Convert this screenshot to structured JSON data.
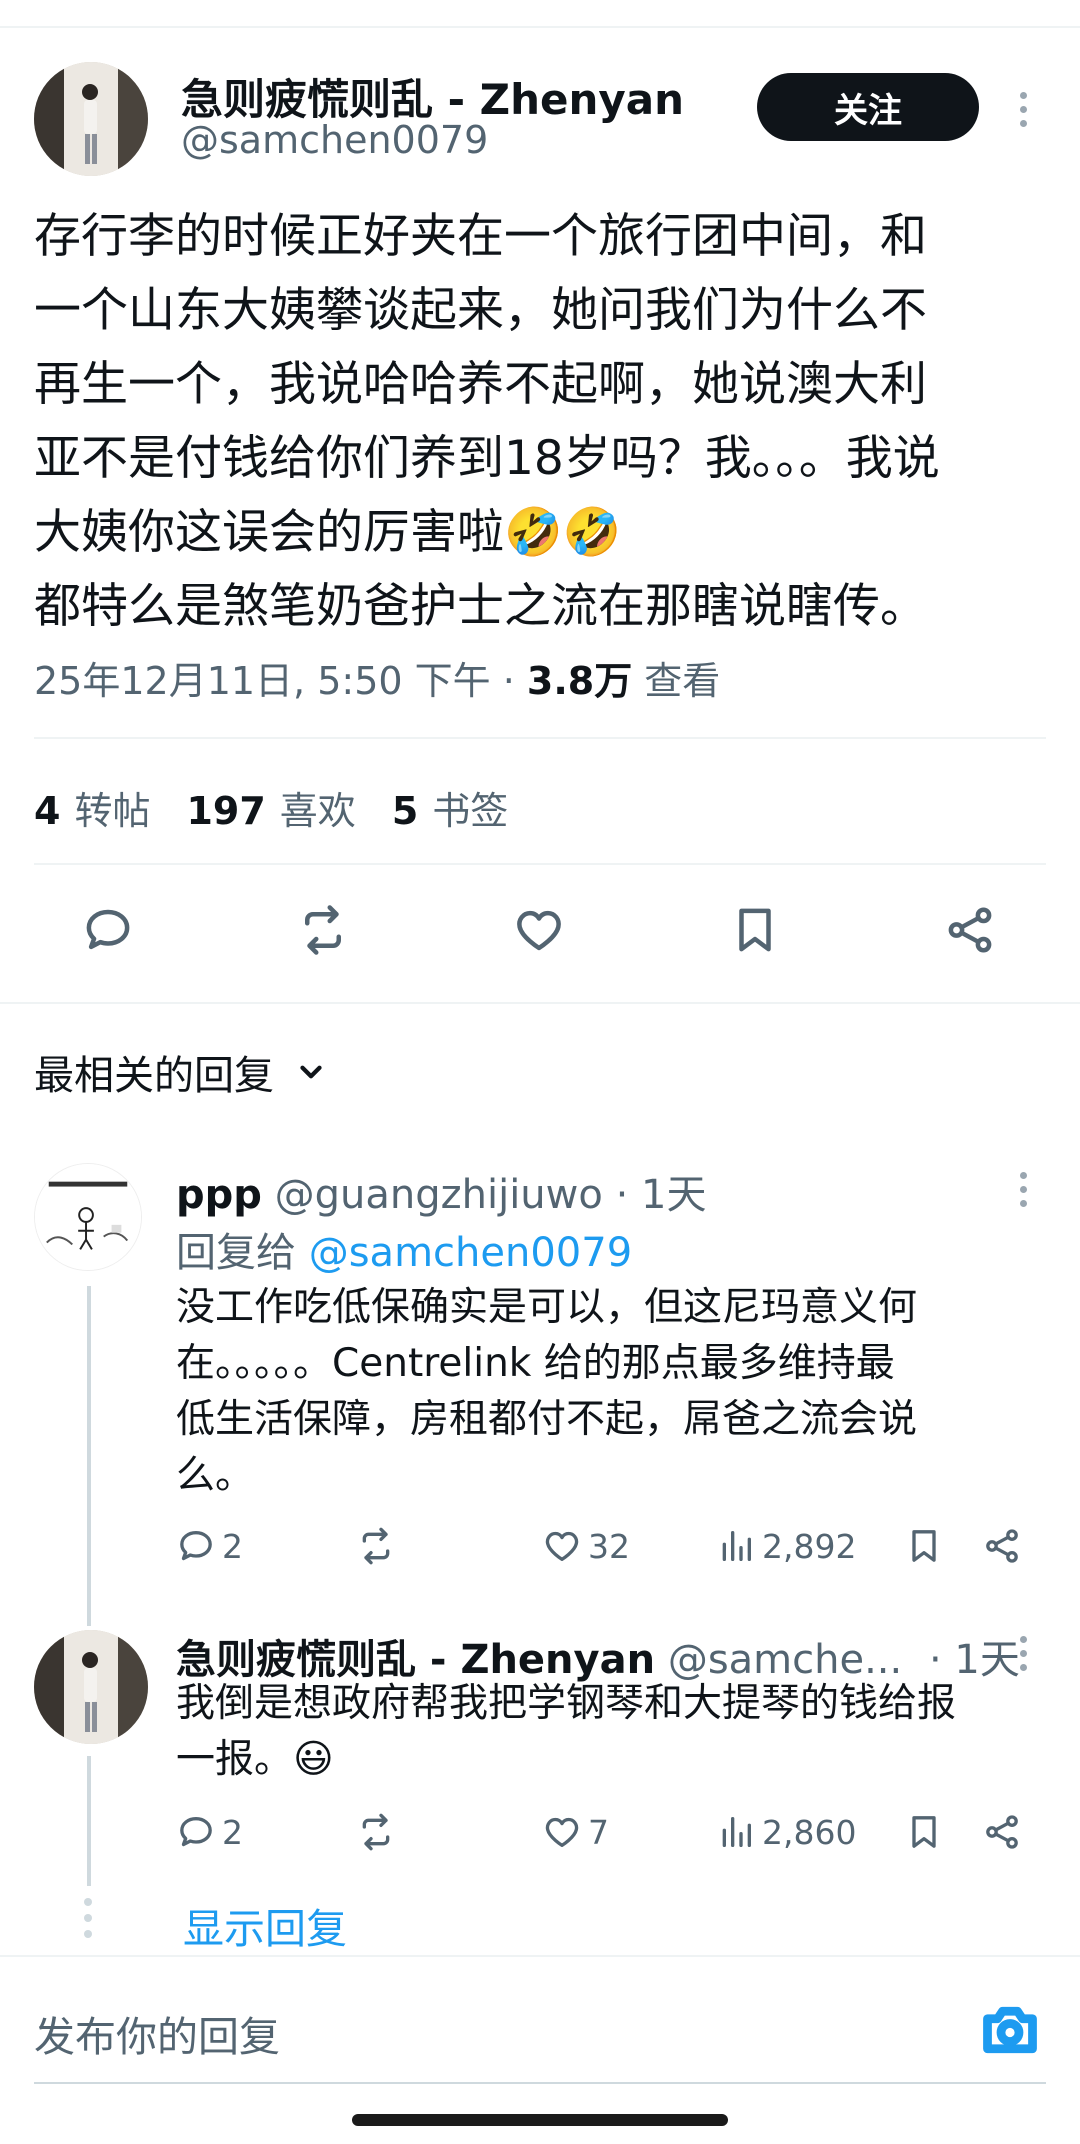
{
  "tweet": {
    "author_name": "急则疲慌则乱 - Zhenyan",
    "author_handle": "@samchen0079",
    "follow_label": "关注",
    "text": "存行李的时候正好夹在一个旅行团中间，和\n一个山东大姨攀谈起来，她问我们为什么不\n再生一个，我说哈哈养不起啊，她说澳大利\n亚不是付钱给你们养到18岁吗？我。。。我说\n大姨你这误会的厉害啦🤣🤣\n都特么是煞笔奶爸护士之流在那瞎说瞎传。",
    "timestamp": "25年12月11日, 5:50 下午 · ",
    "views_count": "3.8万",
    "views_label": "查看",
    "reposts_count": "4",
    "reposts_label": "转帖",
    "likes_count": "197",
    "likes_label": "喜欢",
    "bookmarks_count": "5",
    "bookmarks_label": "书签"
  },
  "icons": {
    "reply": "reply-icon",
    "repost": "repost-icon",
    "like": "heart-icon",
    "bookmark": "bookmark-icon",
    "share": "share-icon",
    "views": "views-icon",
    "chevron": "chevron-down-icon",
    "camera": "camera-icon",
    "more": "more-icon"
  },
  "replies_header": "最相关的回复",
  "replies": [
    {
      "name": "ppp",
      "handle": "@guangzhijiuwo",
      "time": "· 1天",
      "reply_to_label": "回复给",
      "reply_to_handle": "@samchen0079",
      "text": "没工作吃低保确实是可以，但这尼玛意义何\n在。。。。。Centrelink 给的那点最多维持最\n低生活保障，房租都付不起，屌爸之流会说\n么。",
      "reply_count": "2",
      "repost_count": "",
      "like_count": "32",
      "view_count": "2,892"
    },
    {
      "name": "急则疲慌则乱 - Zhenyan",
      "handle": "@samche...",
      "time": "· 1天",
      "text": "我倒是想政府帮我把学钢琴和大提琴的钱给报\n一报。😃",
      "reply_count": "2",
      "repost_count": "",
      "like_count": "7",
      "view_count": "2,860"
    }
  ],
  "show_replies_label": "显示回复",
  "composer_placeholder": "发布你的回复",
  "colors": {
    "accent": "#1d9bf0",
    "text": "#0f1419",
    "muted": "#536471",
    "divider": "#eff3f4"
  }
}
